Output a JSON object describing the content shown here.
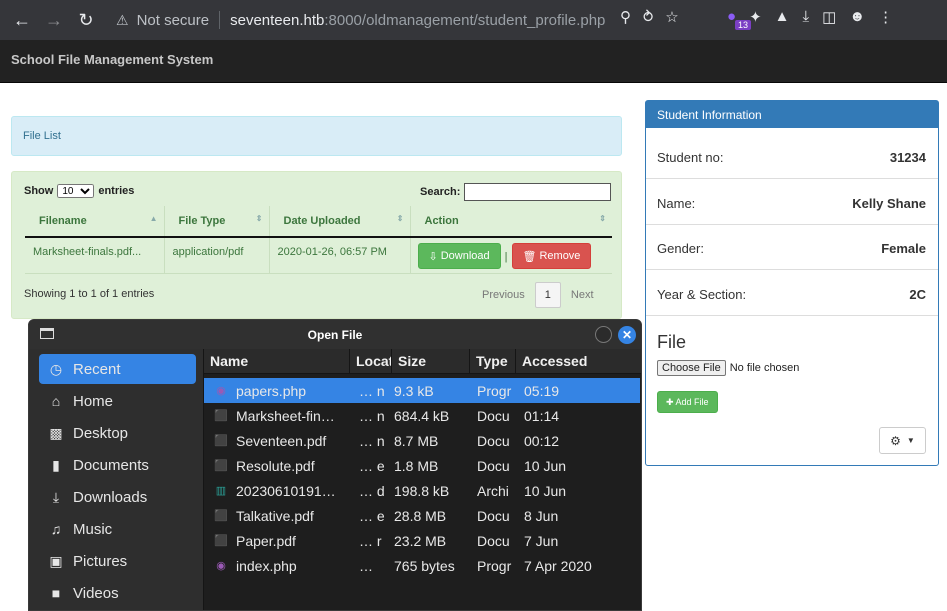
{
  "browser": {
    "security": "Not secure",
    "url_host": "seventeen.htb",
    "url_path": ":8000/oldmanagement/student_profile.php",
    "extension_badge": "13"
  },
  "app": {
    "brand": "School File Management System",
    "file_list_label": "File List"
  },
  "table": {
    "show_label": "Show",
    "entries_label": "entries",
    "page_length": "10",
    "search_label": "Search:",
    "search_value": "",
    "headers": [
      "Filename",
      "File Type",
      "Date Uploaded",
      "Action"
    ],
    "rows": [
      {
        "filename": "Marksheet-finals.pdf...",
        "type": "application/pdf",
        "date": "2020-01-26, 06:57 PM",
        "download": "Download",
        "remove": "Remove"
      }
    ],
    "info": "Showing 1 to 1 of 1 entries",
    "prev": "Previous",
    "page": "1",
    "next": "Next"
  },
  "student": {
    "title": "Student Information",
    "fields": [
      {
        "key": "Student no:",
        "value": "31234"
      },
      {
        "key": "Name:",
        "value": "Kelly Shane"
      },
      {
        "key": "Gender:",
        "value": "Female"
      },
      {
        "key": "Year & Section:",
        "value": "2C"
      }
    ],
    "file_title": "File",
    "choose_label": "Choose File",
    "no_file": "No file chosen",
    "add_file": "Add File"
  },
  "dialog": {
    "title": "Open File",
    "places": [
      {
        "label": "Recent",
        "icon": "clock-icon",
        "selected": true
      },
      {
        "label": "Home",
        "icon": "home-icon"
      },
      {
        "label": "Desktop",
        "icon": "desktop-icon"
      },
      {
        "label": "Documents",
        "icon": "document-icon"
      },
      {
        "label": "Downloads",
        "icon": "download-icon"
      },
      {
        "label": "Music",
        "icon": "music-icon"
      },
      {
        "label": "Pictures",
        "icon": "picture-icon"
      },
      {
        "label": "Videos",
        "icon": "video-icon"
      }
    ],
    "columns": [
      "Name",
      "Locat",
      "Size",
      "Type",
      "Accessed"
    ],
    "files": [
      {
        "name": "papers.php",
        "loc": "… n",
        "size": "9.3 kB",
        "type": "Progr",
        "accessed": "05:19",
        "kind": "php",
        "selected": true
      },
      {
        "name": "Marksheet-fin…",
        "loc": "… n",
        "size": "684.4 kB",
        "type": "Docu",
        "accessed": "01:14",
        "kind": "pdf"
      },
      {
        "name": "Seventeen.pdf",
        "loc": "… n",
        "size": "8.7 MB",
        "type": "Docu",
        "accessed": "00:12",
        "kind": "pdf"
      },
      {
        "name": "Resolute.pdf",
        "loc": "… e",
        "size": "1.8 MB",
        "type": "Docu",
        "accessed": "10 Jun",
        "kind": "pdf"
      },
      {
        "name": "20230610191…",
        "loc": "… d",
        "size": "198.8 kB",
        "type": "Archi",
        "accessed": "10 Jun",
        "kind": "arc"
      },
      {
        "name": "Talkative.pdf",
        "loc": "… e",
        "size": "28.8 MB",
        "type": "Docu",
        "accessed": "8 Jun",
        "kind": "pdf"
      },
      {
        "name": "Paper.pdf",
        "loc": "… r",
        "size": "23.2 MB",
        "type": "Docu",
        "accessed": "7 Jun",
        "kind": "pdf"
      },
      {
        "name": "index.php",
        "loc": "…",
        "size": "765 bytes",
        "type": "Progr",
        "accessed": "7 Apr 2020",
        "kind": "php"
      }
    ]
  }
}
